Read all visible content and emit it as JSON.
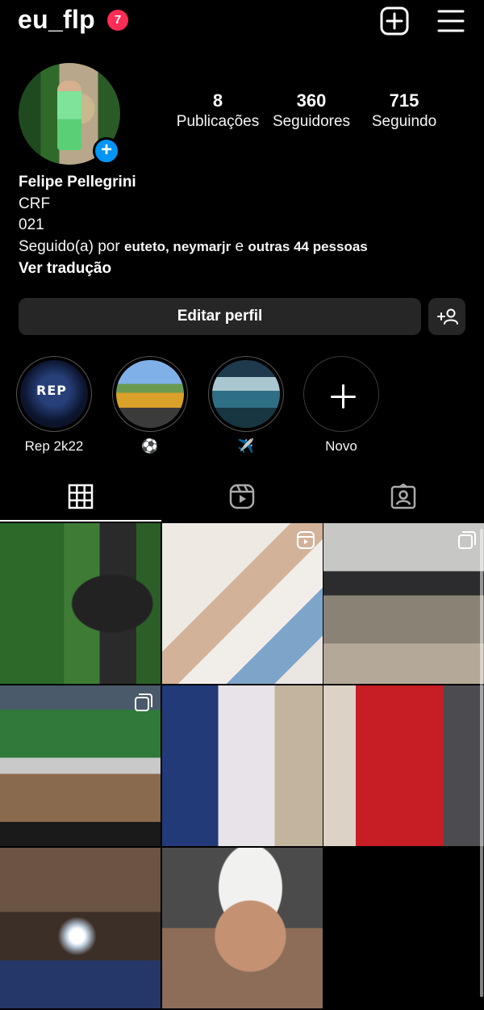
{
  "header": {
    "username": "eu_flp",
    "notification_count": "7",
    "icons": [
      "new-post-icon",
      "menu-icon"
    ]
  },
  "profile": {
    "stats": {
      "posts": {
        "value": "8",
        "label": "Publicações"
      },
      "followers": {
        "value": "360",
        "label": "Seguidores"
      },
      "following": {
        "value": "715",
        "label": "Seguindo"
      }
    },
    "name": "Felipe Pellegrini",
    "bio_lines": [
      "CRF",
      "021"
    ],
    "followed_by": {
      "prefix": "Seguido(a) por",
      "users": "euteto, neymarjr",
      "connector": "e",
      "others": "outras 44 pessoas"
    },
    "translate_label": "Ver tradução"
  },
  "actions": {
    "edit_profile": "Editar perfil",
    "add_person_icon": "add-person-icon"
  },
  "highlights": [
    {
      "label": "Rep 2k22",
      "cover_text": "REP"
    },
    {
      "label": "⚽"
    },
    {
      "label": "✈️"
    },
    {
      "label": "Novo"
    }
  ],
  "tabs": [
    "grid-icon",
    "reels-icon",
    "tagged-icon"
  ],
  "posts": [
    {
      "type": "photo"
    },
    {
      "type": "reel"
    },
    {
      "type": "carousel"
    },
    {
      "type": "carousel"
    },
    {
      "type": "photo"
    },
    {
      "type": "photo"
    },
    {
      "type": "photo"
    },
    {
      "type": "photo"
    }
  ],
  "colors": {
    "background": "#000000",
    "button": "#262626",
    "badge": "#ff2d55",
    "accent": "#0095f6"
  }
}
